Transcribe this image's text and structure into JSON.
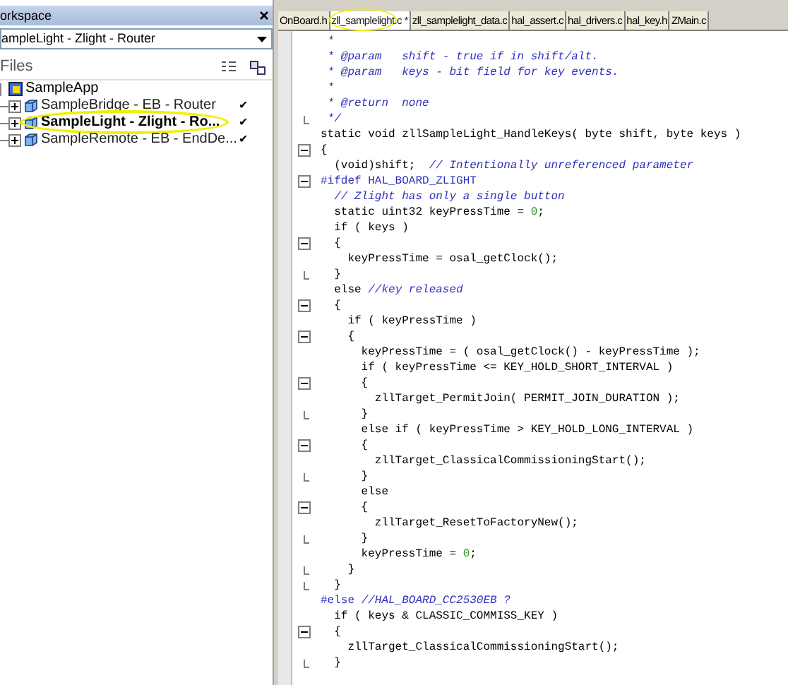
{
  "workspace": {
    "title": "orkspace",
    "config": "ampleLight - Zlight - Router",
    "files_header": "Files",
    "tree": {
      "label": "SampleApp",
      "children": [
        {
          "label": "SampleBridge - EB - Router",
          "checkmark": "✔",
          "active": false,
          "highlighted": false
        },
        {
          "label": "SampleLight - Zlight - Ro...",
          "checkmark": "✔",
          "active": true,
          "highlighted": true
        },
        {
          "label": "SampleRemote - EB - EndDe...",
          "checkmark": "✔",
          "active": false,
          "highlighted": false
        }
      ]
    }
  },
  "tabs": [
    {
      "label": "OnBoard.h",
      "selected": false,
      "highlighted": false
    },
    {
      "label": "zll_samplelight.c *",
      "selected": true,
      "highlighted": true
    },
    {
      "label": "zll_samplelight_data.c",
      "selected": false,
      "highlighted": false
    },
    {
      "label": "hal_assert.c",
      "selected": false,
      "highlighted": false
    },
    {
      "label": "hal_drivers.c",
      "selected": false,
      "highlighted": false
    },
    {
      "label": "hal_key.h",
      "selected": false,
      "highlighted": false
    },
    {
      "label": "ZMain.c",
      "selected": false,
      "highlighted": false
    }
  ],
  "code": [
    {
      "kind": "line",
      "segments": [
        {
          "kind": "comment",
          "text": " *"
        }
      ]
    },
    {
      "kind": "line",
      "segments": [
        {
          "kind": "comment",
          "text": " * @param   shift - true if in shift/alt."
        }
      ]
    },
    {
      "kind": "line",
      "segments": [
        {
          "kind": "comment",
          "text": " * @param   keys - bit field for key events."
        }
      ]
    },
    {
      "kind": "line",
      "segments": [
        {
          "kind": "comment",
          "text": " *"
        }
      ]
    },
    {
      "kind": "line",
      "segments": [
        {
          "kind": "comment",
          "text": " * @return  none"
        }
      ]
    },
    {
      "kind": "fold_end",
      "segments": [
        {
          "kind": "comment",
          "text": " */"
        }
      ]
    },
    {
      "kind": "line",
      "segments": [
        {
          "kind": "plain",
          "text": "static void zllSampleLight_HandleKeys( byte shift, byte keys )"
        }
      ]
    },
    {
      "kind": "fold_start",
      "segments": [
        {
          "kind": "plain",
          "text": "{"
        }
      ]
    },
    {
      "kind": "line",
      "segments": [
        {
          "kind": "plain",
          "text": "  (void)shift;  "
        },
        {
          "kind": "comment",
          "text": "// Intentionally unreferenced parameter"
        }
      ]
    },
    {
      "kind": "fold_start",
      "segments": [
        {
          "kind": "preprocessor",
          "text": "#ifdef HAL_BOARD_ZLIGHT"
        }
      ]
    },
    {
      "kind": "line",
      "segments": [
        {
          "kind": "comment",
          "text": "  // Zlight has only a single button"
        }
      ]
    },
    {
      "kind": "line",
      "segments": [
        {
          "kind": "plain",
          "text": "  static uint32 keyPressTime = "
        },
        {
          "kind": "number",
          "text": "0"
        },
        {
          "kind": "plain",
          "text": ";"
        }
      ]
    },
    {
      "kind": "line",
      "segments": [
        {
          "kind": "plain",
          "text": "  if ( keys )"
        }
      ]
    },
    {
      "kind": "fold_start",
      "segments": [
        {
          "kind": "plain",
          "text": "  {"
        }
      ]
    },
    {
      "kind": "line",
      "segments": [
        {
          "kind": "plain",
          "text": "    keyPressTime = osal_getClock();"
        }
      ]
    },
    {
      "kind": "fold_end",
      "segments": [
        {
          "kind": "plain",
          "text": "  }"
        }
      ]
    },
    {
      "kind": "line",
      "segments": [
        {
          "kind": "plain",
          "text": "  else "
        },
        {
          "kind": "comment",
          "text": "//key released"
        }
      ]
    },
    {
      "kind": "fold_start",
      "segments": [
        {
          "kind": "plain",
          "text": "  {"
        }
      ]
    },
    {
      "kind": "line",
      "segments": [
        {
          "kind": "plain",
          "text": "    if ( keyPressTime )"
        }
      ]
    },
    {
      "kind": "fold_start",
      "segments": [
        {
          "kind": "plain",
          "text": "    {"
        }
      ]
    },
    {
      "kind": "line",
      "segments": [
        {
          "kind": "plain",
          "text": "      keyPressTime = ( osal_getClock() - keyPressTime );"
        }
      ]
    },
    {
      "kind": "line",
      "segments": [
        {
          "kind": "plain",
          "text": "      if ( keyPressTime <= KEY_HOLD_SHORT_INTERVAL )"
        }
      ]
    },
    {
      "kind": "fold_start",
      "segments": [
        {
          "kind": "plain",
          "text": "      {"
        }
      ]
    },
    {
      "kind": "line",
      "segments": [
        {
          "kind": "plain",
          "text": "        zllTarget_PermitJoin( PERMIT_JOIN_DURATION );"
        }
      ]
    },
    {
      "kind": "fold_end",
      "segments": [
        {
          "kind": "plain",
          "text": "      }"
        }
      ]
    },
    {
      "kind": "line",
      "segments": [
        {
          "kind": "plain",
          "text": "      else if ( keyPressTime > KEY_HOLD_LONG_INTERVAL )"
        }
      ]
    },
    {
      "kind": "fold_start",
      "segments": [
        {
          "kind": "plain",
          "text": "      {"
        }
      ]
    },
    {
      "kind": "line",
      "segments": [
        {
          "kind": "plain",
          "text": "        zllTarget_ClassicalCommissioningStart();"
        }
      ]
    },
    {
      "kind": "fold_end",
      "segments": [
        {
          "kind": "plain",
          "text": "      }"
        }
      ]
    },
    {
      "kind": "line",
      "segments": [
        {
          "kind": "plain",
          "text": "      else"
        }
      ]
    },
    {
      "kind": "fold_start",
      "segments": [
        {
          "kind": "plain",
          "text": "      {"
        }
      ]
    },
    {
      "kind": "line",
      "segments": [
        {
          "kind": "plain",
          "text": "        zllTarget_ResetToFactoryNew();"
        }
      ]
    },
    {
      "kind": "fold_end",
      "segments": [
        {
          "kind": "plain",
          "text": "      }"
        }
      ]
    },
    {
      "kind": "line",
      "segments": [
        {
          "kind": "plain",
          "text": "      keyPressTime = "
        },
        {
          "kind": "number",
          "text": "0"
        },
        {
          "kind": "plain",
          "text": ";"
        }
      ]
    },
    {
      "kind": "fold_end",
      "segments": [
        {
          "kind": "plain",
          "text": "    }"
        }
      ]
    },
    {
      "kind": "fold_end",
      "segments": [
        {
          "kind": "plain",
          "text": "  }"
        }
      ]
    },
    {
      "kind": "line",
      "segments": [
        {
          "kind": "preprocessor",
          "text": "#else "
        },
        {
          "kind": "comment",
          "text": "//HAL_BOARD_CC2530EB ?"
        }
      ]
    },
    {
      "kind": "line",
      "segments": [
        {
          "kind": "plain",
          "text": "  if ( keys & CLASSIC_COMMISS_KEY )"
        }
      ]
    },
    {
      "kind": "fold_start",
      "segments": [
        {
          "kind": "plain",
          "text": "  {"
        }
      ]
    },
    {
      "kind": "line",
      "segments": [
        {
          "kind": "plain",
          "text": "    zllTarget_ClassicalCommissioningStart();"
        }
      ]
    },
    {
      "kind": "fold_end",
      "segments": [
        {
          "kind": "plain",
          "text": "  }"
        }
      ]
    }
  ]
}
